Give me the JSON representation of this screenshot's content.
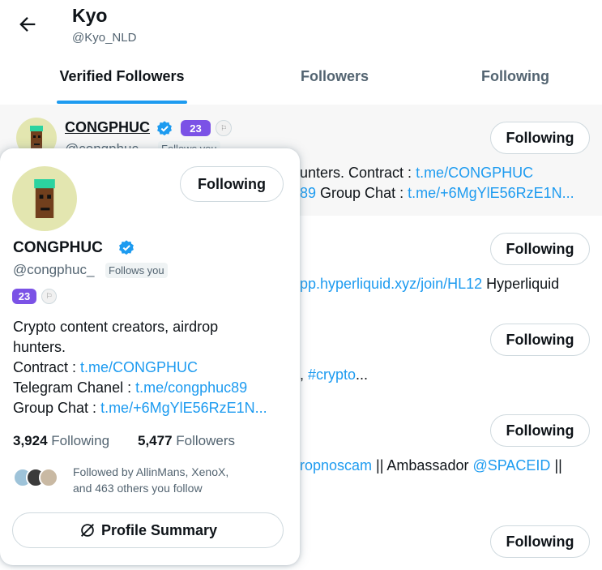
{
  "header": {
    "title": "Kyo",
    "handle": "@Kyo_NLD"
  },
  "tabs": [
    {
      "label": "Verified Followers",
      "active": true
    },
    {
      "label": "Followers",
      "active": false
    },
    {
      "label": "Following",
      "active": false
    }
  ],
  "rows": [
    {
      "name": "CONGPHUC",
      "handle": "@congphuc_",
      "follows_you": "Follows you",
      "badge": "23",
      "button": "Following",
      "bio_line1_text": "unters. Contract : ",
      "bio_line1_link": "t.me/CONGPHUC",
      "bio_line2_link_a": "89",
      "bio_line2_text": " Group Chat : ",
      "bio_line2_link_b": "t.me/+6MgYlE56RzE1N..."
    },
    {
      "button": "Following",
      "bio_link": "pp.hyperliquid.xyz/join/HL12",
      "bio_text": " Hyperliquid"
    },
    {
      "button": "Following",
      "bio_text": ", ",
      "bio_link": "#crypto",
      "bio_more": "..."
    },
    {
      "button": "Following",
      "bio_link": "ropnoscam",
      "bio_text": " || Ambassador ",
      "bio_link2": "@SPACEID",
      "bio_text2": " ||"
    },
    {
      "button": "Following"
    }
  ],
  "card": {
    "button": "Following",
    "name": "CONGPHUC",
    "handle": "@congphuc_",
    "follows_you": "Follows you",
    "badge": "23",
    "bio_line1": "Crypto content creators, airdrop",
    "bio_line2": "hunters.",
    "contract_label": "Contract : ",
    "contract_link": "t.me/CONGPHUC",
    "telegram_label": "Telegram Chanel : ",
    "telegram_link": "t.me/congphuc89",
    "group_label": "Group Chat : ",
    "group_link": "t.me/+6MgYlE56RzE1N...",
    "following_count": "3,924",
    "following_label": "Following",
    "followers_count": "5,477",
    "followers_label": "Followers",
    "followed_by_line1": "Followed by AllinMans, XenoX,",
    "followed_by_line2": "and 463 others you follow",
    "summary_button": "Profile Summary"
  },
  "colors": {
    "accent": "#1d9bf0",
    "badge": "#7b52e6",
    "verified": "#1d9bf0"
  }
}
